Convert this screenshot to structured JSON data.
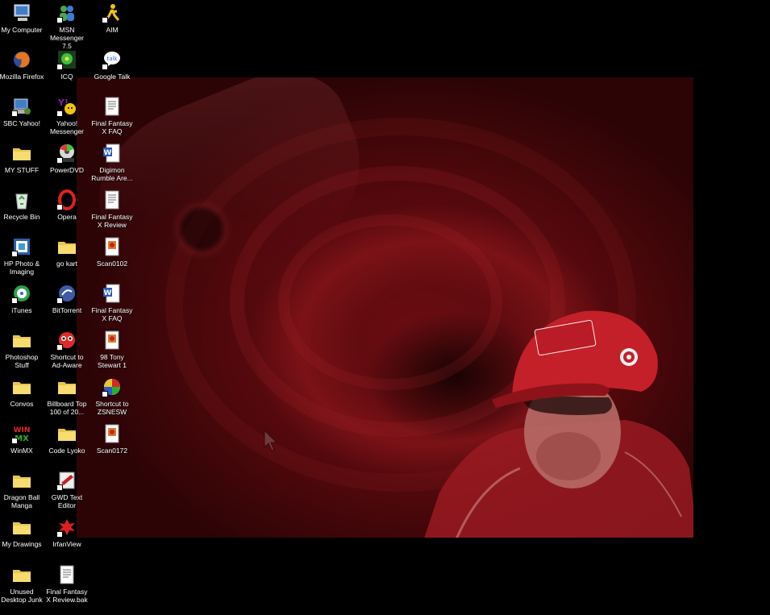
{
  "screen": {
    "background_color": "#000000"
  },
  "wallpaper": {
    "tint": "#6b0d12"
  },
  "icons": [
    {
      "label": "My Computer",
      "icon": "my-computer-icon",
      "col": 0,
      "row": 0
    },
    {
      "label": "MSN Messenger 7.5",
      "icon": "msn-messenger-icon",
      "col": 1,
      "row": 0
    },
    {
      "label": "AIM",
      "icon": "aim-icon",
      "col": 2,
      "row": 0
    },
    {
      "label": "Mozilla Firefox",
      "icon": "firefox-icon",
      "col": 0,
      "row": 1
    },
    {
      "label": "ICQ",
      "icon": "icq-icon",
      "col": 1,
      "row": 1
    },
    {
      "label": "Google Talk",
      "icon": "google-talk-icon",
      "col": 2,
      "row": 1
    },
    {
      "label": "SBC Yahoo!",
      "icon": "sbc-yahoo-icon",
      "col": 0,
      "row": 2
    },
    {
      "label": "Yahoo! Messenger",
      "icon": "yahoo-messenger-icon",
      "col": 1,
      "row": 2
    },
    {
      "label": "Final Fantasy X FAQ",
      "icon": "text-document-icon",
      "col": 2,
      "row": 2
    },
    {
      "label": "MY STUFF",
      "icon": "folder-icon",
      "col": 0,
      "row": 3
    },
    {
      "label": "PowerDVD",
      "icon": "powerdvd-icon",
      "col": 1,
      "row": 3
    },
    {
      "label": "Digimon Rumble Are...",
      "icon": "word-document-icon",
      "col": 2,
      "row": 3
    },
    {
      "label": "Recycle Bin",
      "icon": "recycle-bin-icon",
      "col": 0,
      "row": 4
    },
    {
      "label": "Opera",
      "icon": "opera-icon",
      "col": 1,
      "row": 4
    },
    {
      "label": "Final Fantasy X Review",
      "icon": "text-document-icon",
      "col": 2,
      "row": 4
    },
    {
      "label": "HP Photo & Imaging",
      "icon": "hp-photo-icon",
      "col": 0,
      "row": 5
    },
    {
      "label": "go kart",
      "icon": "folder-icon",
      "col": 1,
      "row": 5
    },
    {
      "label": "Scan0102",
      "icon": "image-file-icon",
      "col": 2,
      "row": 5
    },
    {
      "label": "iTunes",
      "icon": "itunes-icon",
      "col": 0,
      "row": 6
    },
    {
      "label": "BitTorrent",
      "icon": "bittorrent-icon",
      "col": 1,
      "row": 6
    },
    {
      "label": "Final Fantasy X FAQ",
      "icon": "word-document-icon",
      "col": 2,
      "row": 6
    },
    {
      "label": "Photoshop Stuff",
      "icon": "folder-icon",
      "col": 0,
      "row": 7
    },
    {
      "label": "Shortcut to Ad-Aware",
      "icon": "ad-aware-icon",
      "col": 1,
      "row": 7
    },
    {
      "label": "98 Tony Stewart 1",
      "icon": "image-file-icon",
      "col": 2,
      "row": 7
    },
    {
      "label": "Convos",
      "icon": "folder-icon",
      "col": 0,
      "row": 8
    },
    {
      "label": "Billboard Top 100 of 20...",
      "icon": "folder-icon",
      "col": 1,
      "row": 8
    },
    {
      "label": "Shortcut to ZSNESW",
      "icon": "zsnes-icon",
      "col": 2,
      "row": 8
    },
    {
      "label": "WinMX",
      "icon": "winmx-icon",
      "col": 0,
      "row": 9
    },
    {
      "label": "Code Lyoko",
      "icon": "folder-icon",
      "col": 1,
      "row": 9
    },
    {
      "label": "Scan0172",
      "icon": "image-file-icon",
      "col": 2,
      "row": 9
    },
    {
      "label": "Dragon Ball Manga",
      "icon": "folder-icon",
      "col": 0,
      "row": 10
    },
    {
      "label": "GWD Text Editor",
      "icon": "gwd-text-editor-icon",
      "col": 1,
      "row": 10
    },
    {
      "label": "My Drawings",
      "icon": "folder-icon",
      "col": 0,
      "row": 11
    },
    {
      "label": "IrfanView",
      "icon": "irfanview-icon",
      "col": 1,
      "row": 11
    },
    {
      "label": "Unused Desktop Junk",
      "icon": "folder-icon",
      "col": 0,
      "row": 12
    },
    {
      "label": "Final Fantasy X Review.bak",
      "icon": "text-document-icon",
      "col": 1,
      "row": 12
    }
  ]
}
